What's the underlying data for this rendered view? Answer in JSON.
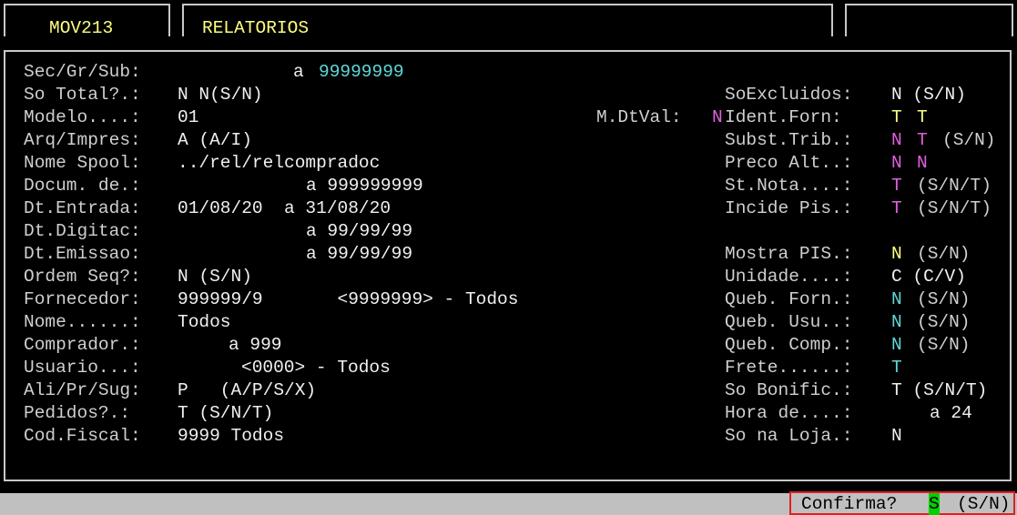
{
  "tabs": [
    "MOV213",
    "RELATORIOS",
    ""
  ],
  "form": {
    "sec_gr_sub": {
      "label": "Sec/Gr/Sub:",
      "a": "a",
      "value": "99999999"
    },
    "so_total": {
      "label": "So Total?.:",
      "value": "N N(S/N)"
    },
    "modelo": {
      "label": "Modelo....:",
      "value": "01"
    },
    "arq_impres": {
      "label": "Arq/Impres:",
      "value": "A (A/I)"
    },
    "nome_spool": {
      "label": "Nome Spool:",
      "value": "../rel/relcompradoc"
    },
    "docum": {
      "label": "Docum. de.:",
      "value": "a 999999999"
    },
    "dt_entrada": {
      "label": "Dt.Entrada:",
      "value": "01/08/20  a 31/08/20"
    },
    "dt_digitac": {
      "label": "Dt.Digitac:",
      "value": "a 99/99/99"
    },
    "dt_emissao": {
      "label": "Dt.Emissao:",
      "value": "a 99/99/99"
    },
    "ordem_seq": {
      "label": "Ordem Seq?:",
      "value": "N (S/N)"
    },
    "fornecedor": {
      "label": "Fornecedor:",
      "value": "999999/9       <9999999> - Todos"
    },
    "nome": {
      "label": "Nome......:",
      "value": "Todos"
    },
    "comprador": {
      "label": "Comprador.:",
      "value": "a 999"
    },
    "usuario": {
      "label": "Usuario...:",
      "value": "<0000> - Todos"
    },
    "ali_pr_sug": {
      "label": "Ali/Pr/Sug:",
      "value": "P   (A/P/S/X)"
    },
    "pedidos": {
      "label": "Pedidos?.:",
      "value": "T (S/N/T)"
    },
    "cod_fiscal": {
      "label": "Cod.Fiscal:",
      "value": "9999 Todos"
    },
    "so_excluidos": {
      "label": "SoExcluidos:",
      "value": "N (S/N)"
    },
    "m_dtval": {
      "label": "M.DtVal:",
      "value": "N"
    },
    "ident_forn": {
      "label": "Ident.Forn:",
      "v1": "T",
      "v2": "T"
    },
    "subst_trib": {
      "label": "Subst.Trib.:",
      "v1": "N",
      "v2": "T",
      "opts": "(S/N)"
    },
    "preco_alt": {
      "label": "Preco Alt..:",
      "v1": "N",
      "v2": "N"
    },
    "st_nota": {
      "label": "St.Nota....:",
      "v1": "T",
      "opts": "(S/N/T)"
    },
    "incide_pis": {
      "label": "Incide Pis.:",
      "v1": "T",
      "opts": "(S/N/T)"
    },
    "mostra_pis": {
      "label": "Mostra PIS.:",
      "v1": "N",
      "opts": "(S/N)"
    },
    "unidade": {
      "label": "Unidade....:",
      "value": "C (C/V)"
    },
    "queb_forn": {
      "label": "Queb. Forn.:",
      "v1": "N",
      "opts": "(S/N)"
    },
    "queb_usu": {
      "label": "Queb. Usu..:",
      "v1": "N",
      "opts": "(S/N)"
    },
    "queb_comp": {
      "label": "Queb. Comp.:",
      "v1": "N",
      "opts": "(S/N)"
    },
    "frete": {
      "label": "Frete......:",
      "v1": "T"
    },
    "so_bonific": {
      "label": "So Bonific.:",
      "value": "T (S/N/T)"
    },
    "hora_de": {
      "label": "Hora de....:",
      "value": "a 24"
    },
    "so_na_loja": {
      "label": "So na Loja.:",
      "value": "N"
    }
  },
  "confirm": {
    "label": "Confirma?",
    "value": "S",
    "opts": "(S/N)"
  }
}
